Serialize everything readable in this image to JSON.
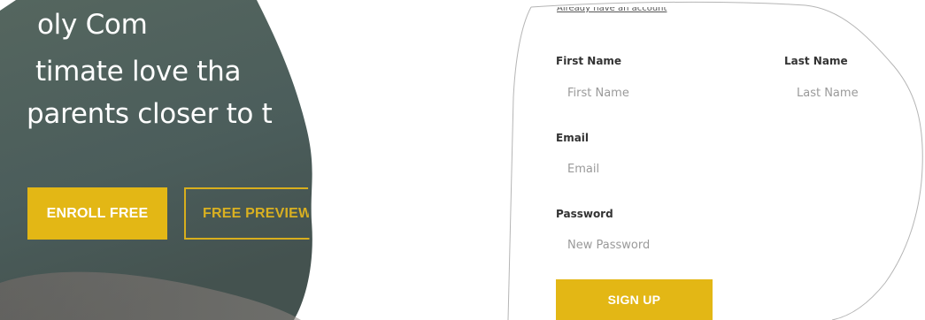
{
  "hero": {
    "line1": "oly Com",
    "line2": "timate love tha",
    "line3": "parents closer to t",
    "enroll_label": "ENROLL FREE",
    "preview_label": "FREE PREVIEW",
    "accent_color": "#e3b715",
    "background_color": "#4d5f5c"
  },
  "signup": {
    "already_link": "Already have an account",
    "first_name_label": "First Name",
    "first_name_placeholder": "First Name",
    "last_name_label": "Last Name",
    "last_name_placeholder": "Last Name",
    "email_label": "Email",
    "email_placeholder": "Email",
    "password_label": "Password",
    "password_placeholder": "New Password",
    "submit_label": "SIGN UP",
    "button_color": "#e3b715"
  }
}
